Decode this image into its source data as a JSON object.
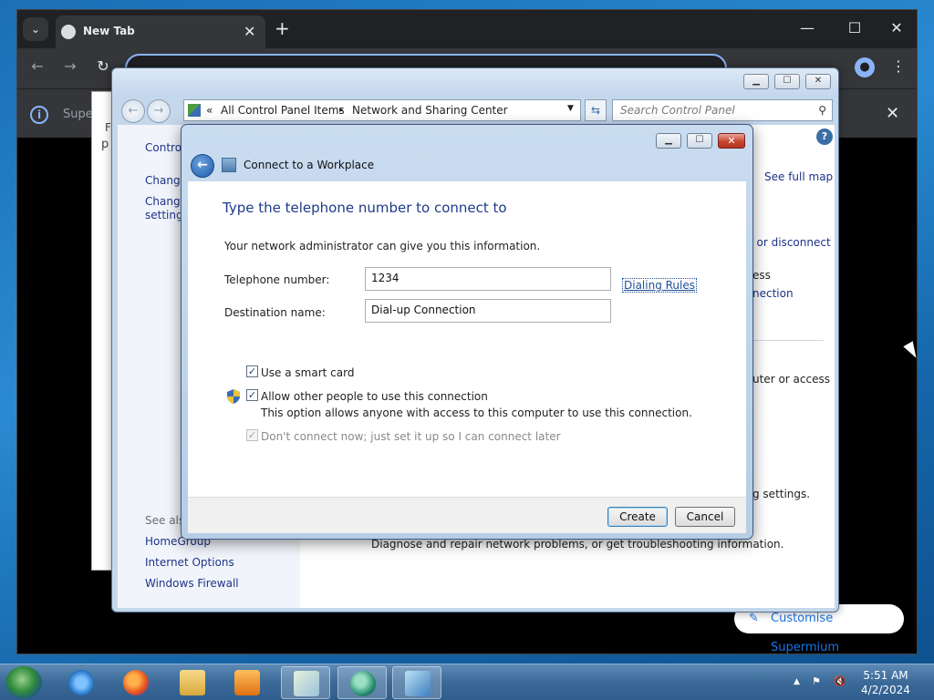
{
  "browser": {
    "tab_title": "New Tab",
    "tab_close": "✕",
    "new_tab": "+",
    "minimize": "—",
    "maximize": "☐",
    "close": "✕",
    "back": "←",
    "forward": "→",
    "reload": "↻",
    "menu": "⋮",
    "infobar_text": "Supe",
    "infobar_close": "✕",
    "customise_label": "Customise Supermium"
  },
  "bg_window": {
    "frag1": "F",
    "frag2": "p"
  },
  "control_panel": {
    "minimize": "▁",
    "maximize": "☐",
    "close": "✕",
    "breadcrumb_prefix": "«",
    "breadcrumb_1": "All Control Panel Items",
    "breadcrumb_sep": "▸",
    "breadcrumb_2": "Network and Sharing Center",
    "search_placeholder": "Search Control Panel",
    "left_links": [
      "Control",
      "Change",
      "Change",
      "settings"
    ],
    "see_also_label": "See also",
    "see_also": [
      "HomeGroup",
      "Internet Options",
      "Windows Firewall"
    ],
    "right_fragments": {
      "see_full_map": "See full map",
      "or_disconnect": "t or disconnect",
      "ess": "ess",
      "nection": "nection",
      "uter_or_access": "uter or access",
      "g_settings": "g settings.",
      "diagnose": "Diagnose and repair network problems, or get troubleshooting information."
    }
  },
  "dialog": {
    "title": "Connect to a Workplace",
    "minimize": "▁",
    "maximize": "☐",
    "close": "✕",
    "heading": "Type the telephone number to connect to",
    "subtext": "Your network administrator can give you this information.",
    "phone_label": "Telephone number:",
    "phone_value": "1234",
    "dialing_rules": "Dialing Rules",
    "dest_label": "Destination name:",
    "dest_value": "Dial-up Connection",
    "smart_card_label": "Use a smart card",
    "allow_others_label": "Allow other people to use this connection",
    "allow_others_desc": "This option allows anyone with access to this computer to use this connection.",
    "dont_connect_label": "Don't connect now; just set it up so I can connect later",
    "create": "Create",
    "cancel": "Cancel",
    "checked_mark": "✓"
  },
  "taskbar": {
    "time": "5:51 AM",
    "date": "4/2/2024",
    "tray_arrow": "▲"
  },
  "colors": {
    "accent": "#1e3a8a",
    "link": "#1e3287",
    "taskbar": "#3b6a99"
  }
}
